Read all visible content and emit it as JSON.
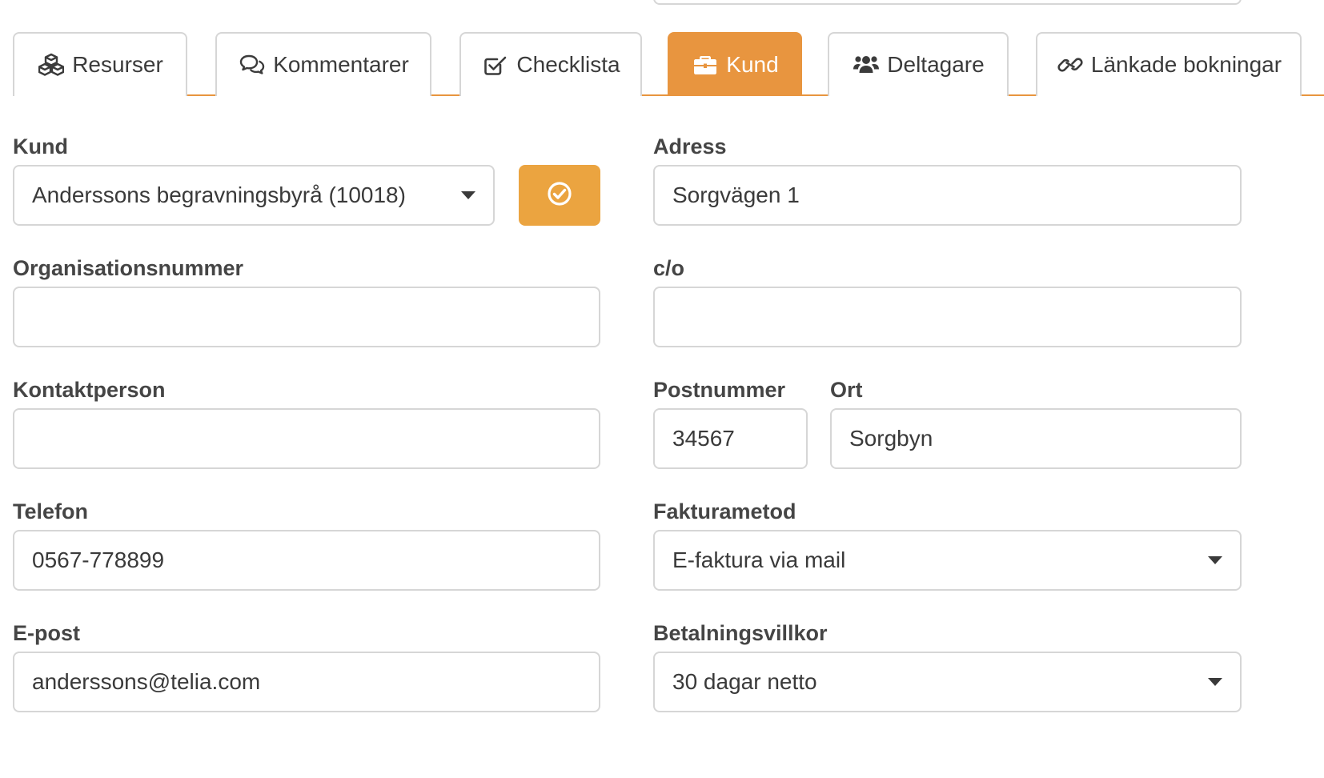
{
  "tabs": [
    {
      "label": "Resurser",
      "icon": "cubes-icon"
    },
    {
      "label": "Kommentarer",
      "icon": "comments-icon"
    },
    {
      "label": "Checklista",
      "icon": "check-square-icon"
    },
    {
      "label": "Kund",
      "icon": "briefcase-icon",
      "active": true
    },
    {
      "label": "Deltagare",
      "icon": "users-icon"
    },
    {
      "label": "Länkade bokningar",
      "icon": "link-icon"
    }
  ],
  "form": {
    "kund": {
      "label": "Kund",
      "value": "Anderssons begravningsbyrå (10018)"
    },
    "org": {
      "label": "Organisationsnummer",
      "value": ""
    },
    "kontakt": {
      "label": "Kontaktperson",
      "value": ""
    },
    "telefon": {
      "label": "Telefon",
      "value": "0567-778899"
    },
    "epost": {
      "label": "E-post",
      "value": "anderssons@telia.com"
    },
    "adress": {
      "label": "Adress",
      "value": "Sorgvägen 1"
    },
    "co": {
      "label": "c/o",
      "value": ""
    },
    "postnummer": {
      "label": "Postnummer",
      "value": "34567"
    },
    "ort": {
      "label": "Ort",
      "value": "Sorgbyn"
    },
    "fakturametod": {
      "label": "Fakturametod",
      "value": "E-faktura via mail"
    },
    "betalningsvillkor": {
      "label": "Betalningsvillkor",
      "value": "30 dagar netto"
    }
  },
  "colors": {
    "accent": "#e8953f",
    "button": "#eba440",
    "border": "#d6d6d6"
  }
}
